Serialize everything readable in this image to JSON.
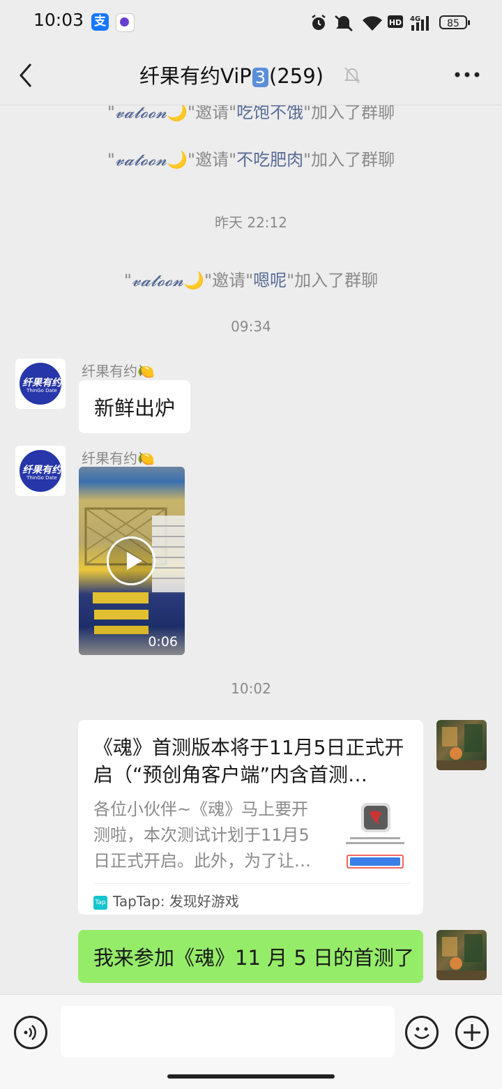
{
  "status_bar": {
    "time": "10:03",
    "alipay_glyph": "支",
    "battery": "85",
    "icons": [
      "alipay-icon",
      "qq-icon",
      "alarm-icon",
      "mute-icon",
      "wifi-icon",
      "hd-icon",
      "4g-signal-icon",
      "battery-icon"
    ]
  },
  "header": {
    "title_prefix": "纤果有约ViP",
    "title_badge": "3",
    "title_suffix": "(259)",
    "icons": [
      "back-icon",
      "mute-bell-icon",
      "more-icon"
    ]
  },
  "messages": {
    "sys1": {
      "q1": "\"",
      "name": "𝓿𝓪𝓽𝓸𝓸𝓷",
      "moon": "🌙",
      "mid": "\"邀请\"",
      "target": "吃饱不饿",
      "end": "\"加入了群聊"
    },
    "sys2": {
      "q1": "\"",
      "name": "𝓿𝓪𝓽𝓸𝓸𝓷",
      "moon": "🌙",
      "mid": "\"邀请\"",
      "target": "不吃肥肉",
      "end": "\"加入了群聊"
    },
    "time1": "昨天 22:12",
    "sys3": {
      "q1": "\"",
      "name": "𝓿𝓪𝓽𝓸𝓸𝓷",
      "moon": "🌙",
      "mid": "\"邀请\"",
      "target": "嗯呢",
      "end": "\"加入了群聊"
    },
    "time2": "09:34",
    "msg1": {
      "sender": "纤果有约🍋",
      "text": "新鲜出炉"
    },
    "msg2": {
      "sender": "纤果有约🍋",
      "video_duration": "0:06"
    },
    "time3": "10:02",
    "card": {
      "title": "《魂》首测版本将于11月5日正式开启（“预创角客户端”内含首测…",
      "desc": "各位小伙伴~《魂》马上要开测啦，本次测试计划于11月5日正式开启。此外，为了让…",
      "source_icon": "Tap",
      "source": "TapTap: 发现好游戏"
    },
    "msg_me": {
      "text": "我来参加《魂》11 月 5 日的首测了"
    }
  },
  "avatar": {
    "brand_text": "纤果有约",
    "brand_sub": "ThinGo Date"
  },
  "input_bar": {
    "placeholder": ""
  },
  "colors": {
    "bg": "#ededed",
    "my_bubble": "#95ec69",
    "name_link": "#576b95",
    "accent": "#1677ff"
  }
}
